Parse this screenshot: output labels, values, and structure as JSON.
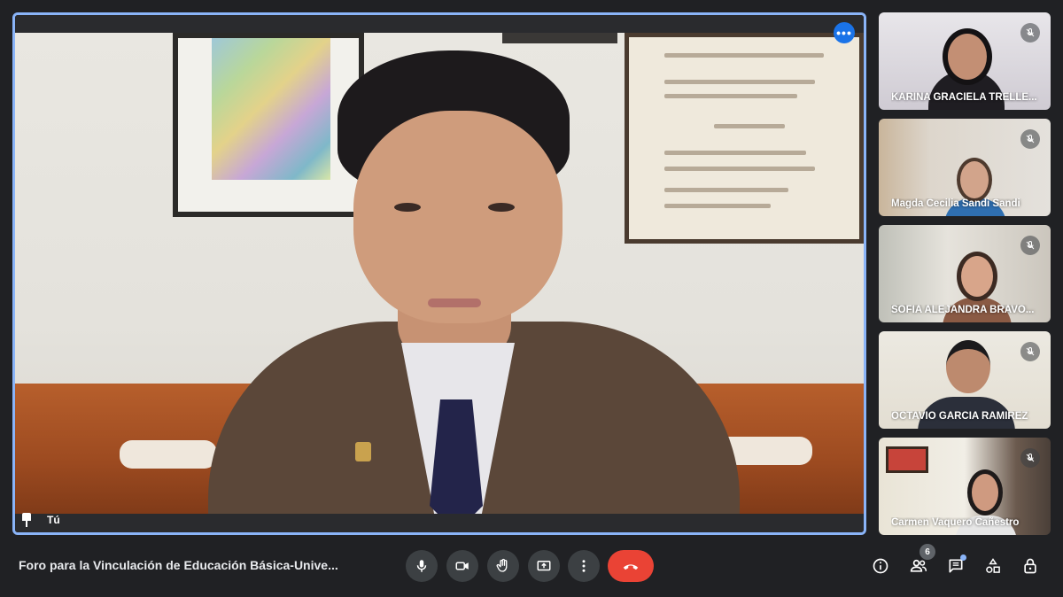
{
  "main_video": {
    "self_label": "Tú",
    "more_options_glyph": "•••"
  },
  "participants": [
    {
      "name": "KARINA GRACIELA TRELLE...",
      "muted": true
    },
    {
      "name": "Magda Cecilia Sandi Sandi",
      "muted": true
    },
    {
      "name": "SOFIA ALEJANDRA BRAVO...",
      "muted": true
    },
    {
      "name": "OCTAVIO GARCÍA RAMÍREZ",
      "muted": true
    },
    {
      "name": "Carmen Vaquero Cañestro",
      "muted": true
    }
  ],
  "toolbar": {
    "meeting_title": "Foro para la Vinculación de Educación Básica-Unive...",
    "controls": [
      "microphone-icon",
      "camera-icon",
      "raise-hand-icon",
      "present-screen-icon",
      "more-options-icon",
      "end-call-icon"
    ],
    "right_controls": [
      "info-icon",
      "people-icon",
      "chat-icon",
      "activities-icon",
      "host-controls-icon"
    ],
    "participant_count": "6"
  },
  "colors": {
    "active_speaker_border": "#8ab4f8",
    "end_call": "#ea4335",
    "accent_button": "#1a73e8",
    "background": "#202124"
  }
}
